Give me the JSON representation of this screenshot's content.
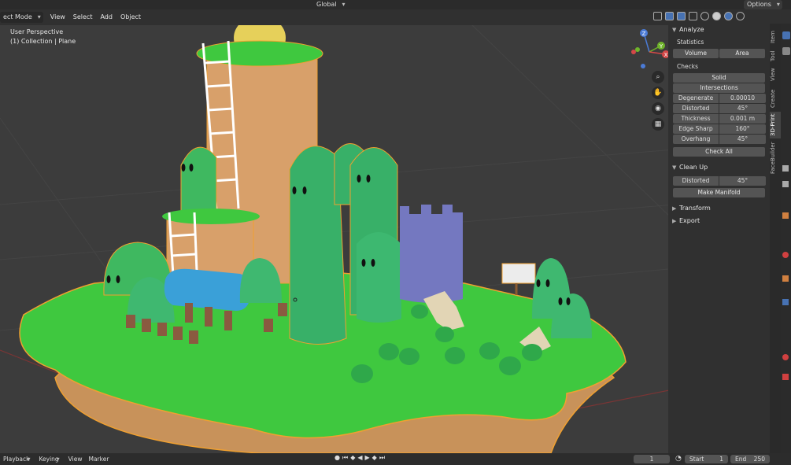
{
  "header": {
    "mode": "ect Mode",
    "menus": [
      "View",
      "Select",
      "Add",
      "Object"
    ],
    "orientation": "Global",
    "options": "Options"
  },
  "viewport": {
    "perspective": "User Perspective",
    "collection": "(1) Collection | Plane",
    "gizmo_axes": [
      "Z",
      "Y",
      "X"
    ]
  },
  "npanel": {
    "analyze": {
      "title": "Analyze",
      "statistics_label": "Statistics",
      "volume": "Volume",
      "area": "Area",
      "checks_label": "Checks",
      "solid": "Solid",
      "intersections": "Intersections",
      "rows": [
        {
          "label": "Degenerate",
          "value": "0.00010"
        },
        {
          "label": "Distorted",
          "value": "45°"
        },
        {
          "label": "Thickness",
          "value": "0.001 m"
        },
        {
          "label": "Edge Sharp",
          "value": "160°"
        },
        {
          "label": "Overhang",
          "value": "45°"
        }
      ],
      "check_all": "Check All"
    },
    "cleanup": {
      "title": "Clean Up",
      "distorted_label": "Distorted",
      "distorted_value": "45°",
      "make_manifold": "Make Manifold"
    },
    "transform": "Transform",
    "export": "Export"
  },
  "tabs": [
    "Item",
    "Tool",
    "View",
    "Create",
    "3D-Print",
    "FaceBuilder"
  ],
  "timeline": {
    "playback": "Playback",
    "keying": "Keying",
    "view": "View",
    "marker": "Marker",
    "current_frame": "1",
    "start_label": "Start",
    "start": "1",
    "end_label": "End",
    "end": "250"
  }
}
